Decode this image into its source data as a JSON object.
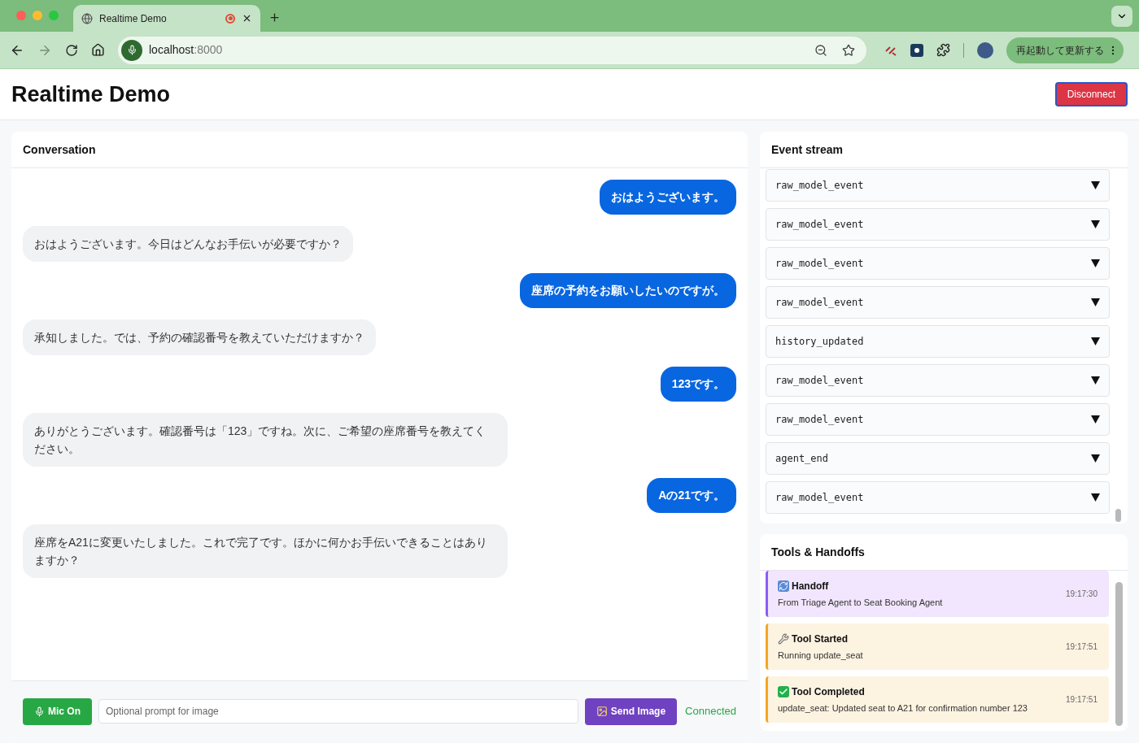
{
  "browser": {
    "tab_title": "Realtime Demo",
    "url_host": "localhost",
    "url_port": ":8000",
    "update_button": "再起動して更新する"
  },
  "header": {
    "title": "Realtime Demo",
    "disconnect_button": "Disconnect"
  },
  "conversation": {
    "title": "Conversation",
    "messages": [
      {
        "kind": "user",
        "text": "おはようございます。"
      },
      {
        "kind": "assistant",
        "text": "おはようございます。今日はどんなお手伝いが必要ですか？"
      },
      {
        "kind": "user",
        "text": "座席の予約をお願いしたいのですが。"
      },
      {
        "kind": "assistant",
        "text": "承知しました。では、予約の確認番号を教えていただけますか？"
      },
      {
        "kind": "user",
        "text": "123です。"
      },
      {
        "kind": "assistant",
        "text": "ありがとうございます。確認番号は「123」ですね。次に、ご希望の座席番号を教えてください。"
      },
      {
        "kind": "user",
        "text": "Aの21です。"
      },
      {
        "kind": "assistant",
        "text": "座席をA21に変更いたしました。これで完了です。ほかに何かお手伝いできることはありますか？"
      }
    ],
    "mic_button": "Mic On",
    "prompt_placeholder": "Optional prompt for image",
    "send_image_button": "Send Image",
    "status": "Connected"
  },
  "event_stream": {
    "title": "Event stream",
    "events": [
      {
        "name": "raw_model_event"
      },
      {
        "name": "raw_model_event"
      },
      {
        "name": "raw_model_event"
      },
      {
        "name": "raw_model_event"
      },
      {
        "name": "history_updated"
      },
      {
        "name": "raw_model_event"
      },
      {
        "name": "raw_model_event"
      },
      {
        "name": "agent_end"
      },
      {
        "name": "raw_model_event"
      }
    ]
  },
  "tools": {
    "title": "Tools & Handoffs",
    "entries": [
      {
        "kind": "handoff",
        "title": "Handoff",
        "detail": "From Triage Agent to Seat Booking Agent",
        "time": "19:17:30"
      },
      {
        "kind": "tool_started",
        "title": "Tool Started",
        "detail": "Running update_seat",
        "time": "19:17:51"
      },
      {
        "kind": "tool_completed",
        "title": "Tool Completed",
        "detail": "update_seat: Updated seat to A21 for confirmation number 123",
        "time": "19:17:51"
      }
    ]
  }
}
